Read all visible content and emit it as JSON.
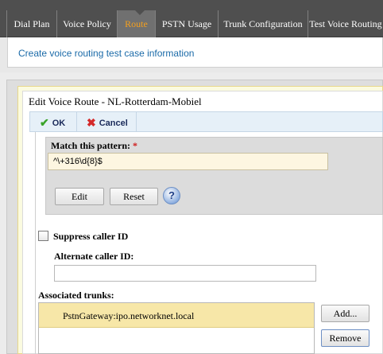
{
  "nav": {
    "tabs": [
      {
        "label": "Dial Plan",
        "active": false
      },
      {
        "label": "Voice Policy",
        "active": false
      },
      {
        "label": "Route",
        "active": true
      },
      {
        "label": "PSTN Usage",
        "active": false
      },
      {
        "label": "Trunk Configuration",
        "active": false
      },
      {
        "label": "Test Voice Routing",
        "active": false
      }
    ]
  },
  "subheader": {
    "link_text": "Create voice routing test case information"
  },
  "dialog": {
    "title": "Edit Voice Route - NL-Rotterdam-Mobiel",
    "toolbar": {
      "ok_label": "OK",
      "cancel_label": "Cancel"
    },
    "pattern": {
      "label": "Match this pattern:",
      "required_mark": "*",
      "value": "^\\+316\\d{8}$",
      "edit_label": "Edit",
      "reset_label": "Reset",
      "help_glyph": "?"
    },
    "suppress_caller_id": {
      "label": "Suppress caller ID",
      "checked": false
    },
    "alternate_caller_id": {
      "label": "Alternate caller ID:",
      "value": ""
    },
    "associated_trunks": {
      "label": "Associated trunks:",
      "items": [
        "PstnGateway:ipo.networknet.local"
      ],
      "add_label": "Add...",
      "remove_label": "Remove"
    }
  },
  "colors": {
    "nav_bg": "#4f4f4f",
    "nav_active": "#f5a01e",
    "link": "#1a6aa8",
    "selected_row": "#f7e7a8",
    "required": "#d02020"
  }
}
